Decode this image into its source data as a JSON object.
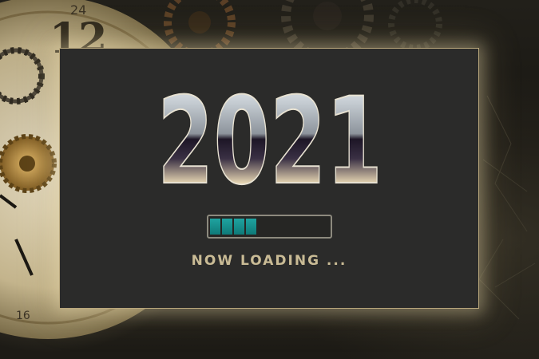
{
  "title": "2021",
  "status_text": "NOW LOADING ...",
  "progress": {
    "segments_filled": 4,
    "segments_total": 10,
    "fraction": 0.4
  },
  "clock_numerals": [
    "24",
    "12",
    "16"
  ],
  "colors": {
    "panel": "#2b2b2a",
    "panel_border": "#b9a77c",
    "progress_fill": "#1fa3a0",
    "status_text": "#c9bb95"
  }
}
